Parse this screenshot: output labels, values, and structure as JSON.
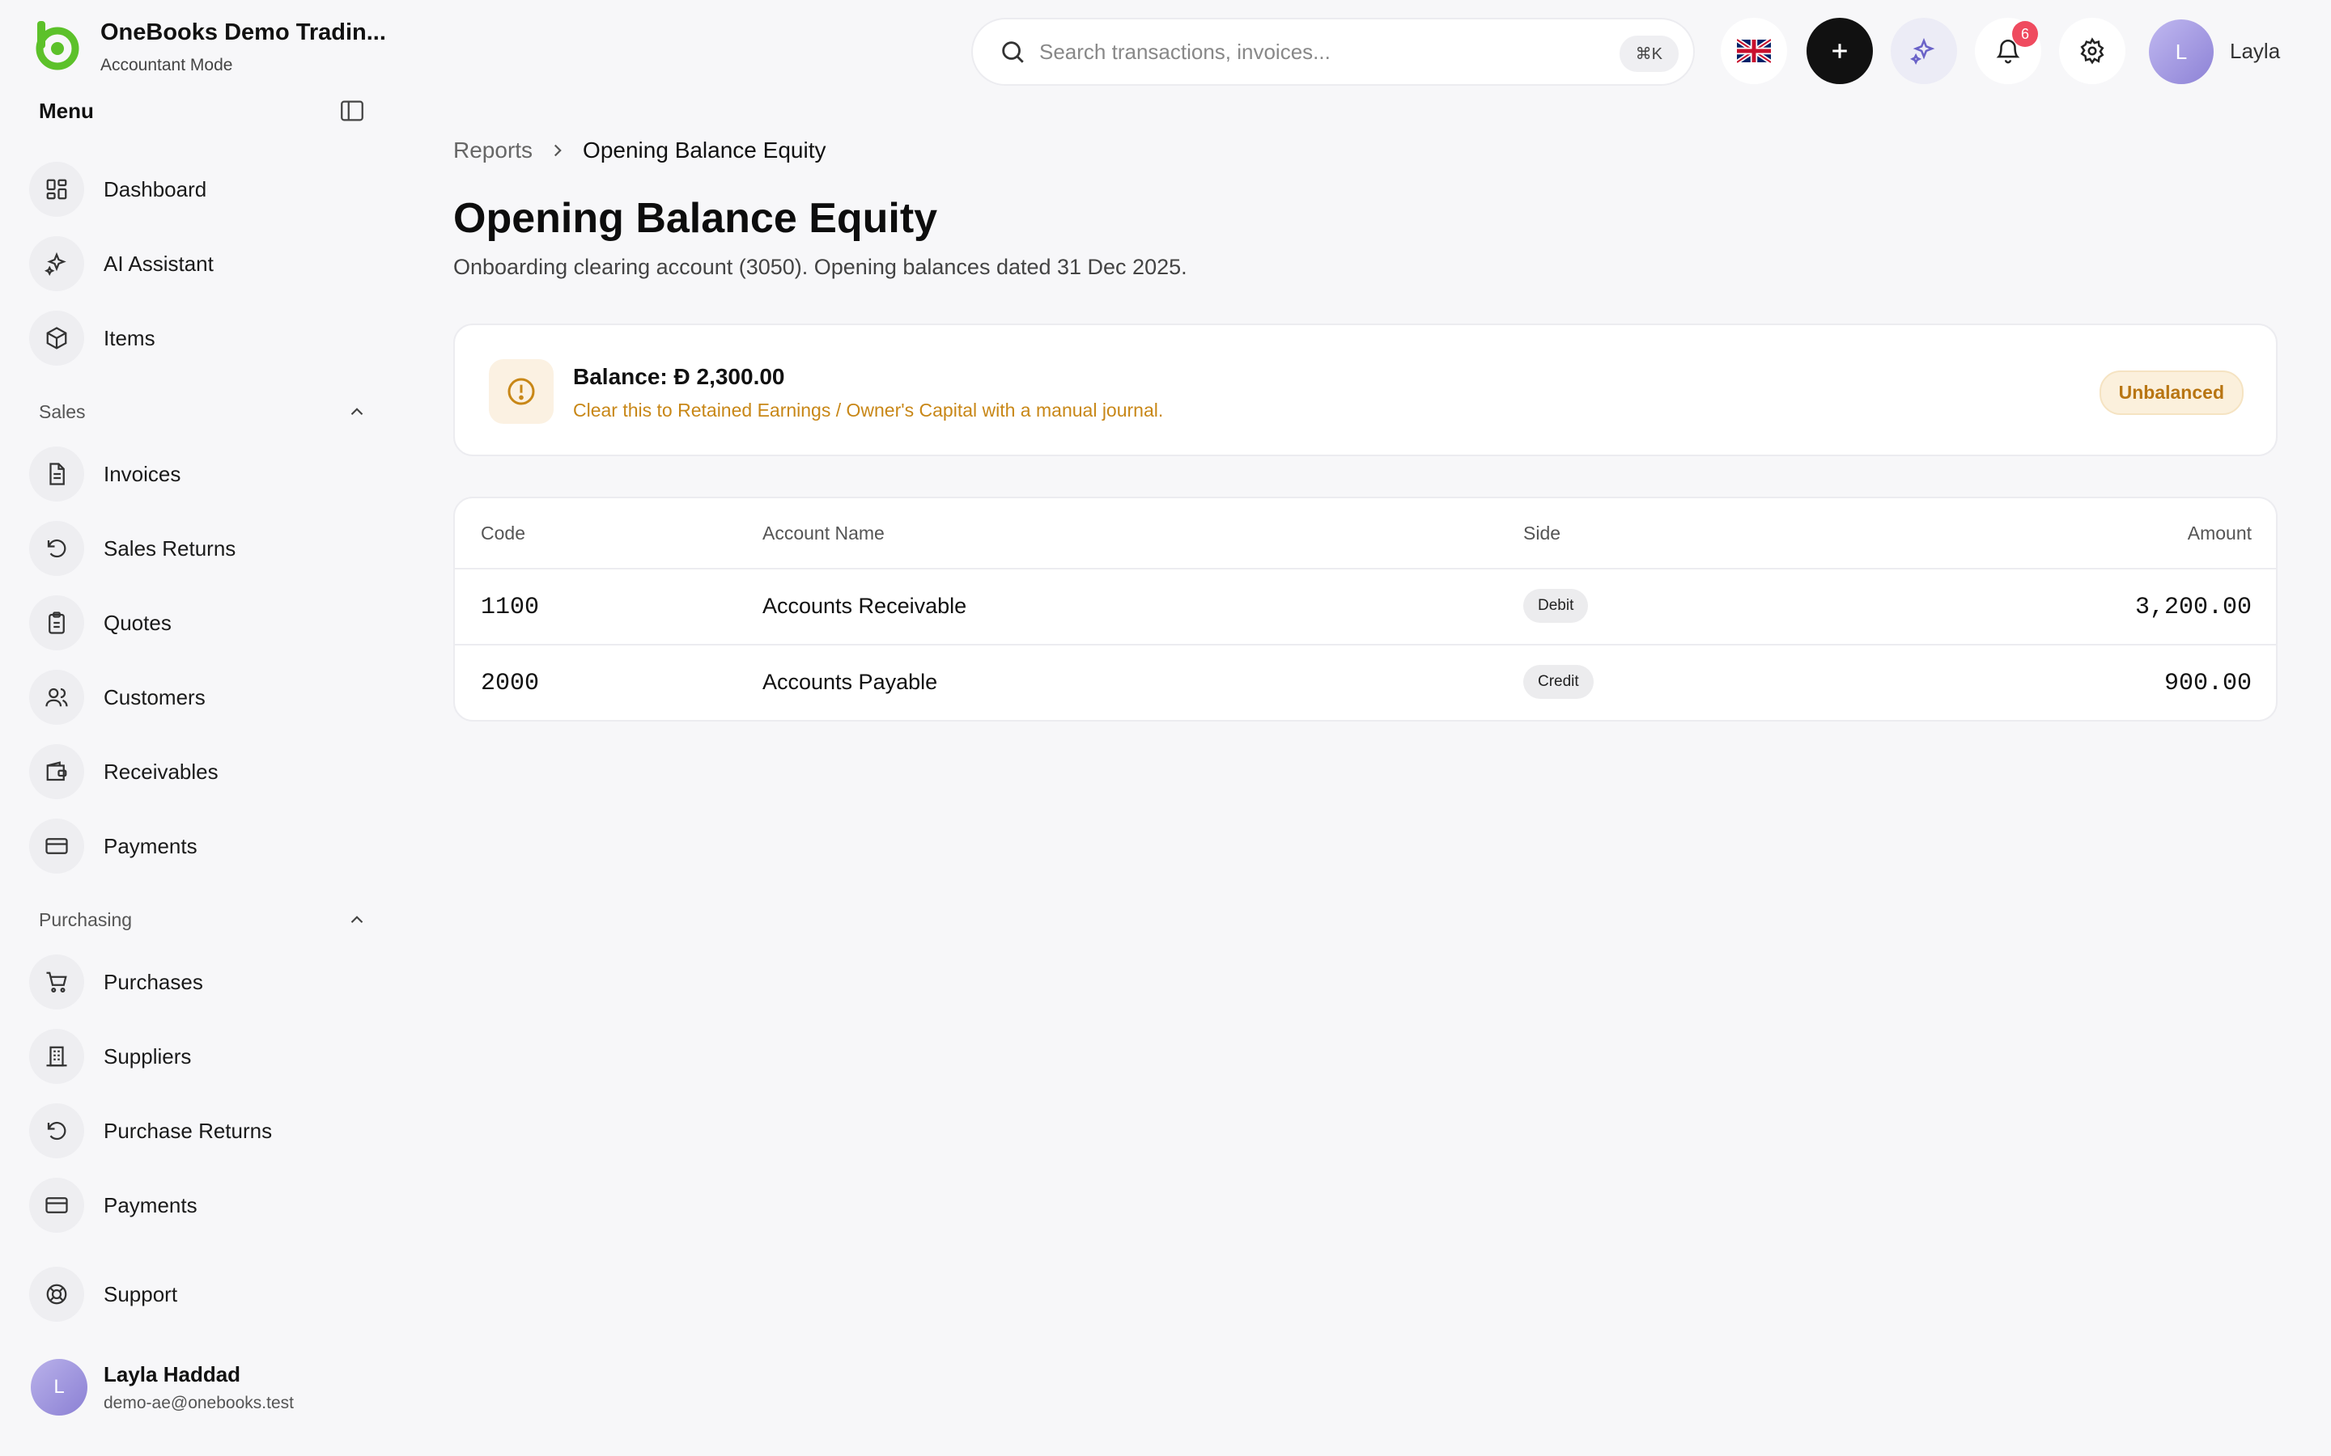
{
  "company": {
    "name": "OneBooks Demo Tradin...",
    "mode": "Accountant Mode"
  },
  "menu": {
    "title": "Menu"
  },
  "nav_top": [
    {
      "label": "Dashboard",
      "icon": "dashboard-icon"
    },
    {
      "label": "AI Assistant",
      "icon": "sparkles-icon"
    },
    {
      "label": "Items",
      "icon": "box-icon"
    }
  ],
  "sales": {
    "title": "Sales",
    "items": [
      {
        "label": "Invoices",
        "icon": "file-icon"
      },
      {
        "label": "Sales Returns",
        "icon": "undo-icon"
      },
      {
        "label": "Quotes",
        "icon": "clipboard-icon"
      },
      {
        "label": "Customers",
        "icon": "users-icon"
      },
      {
        "label": "Receivables",
        "icon": "wallet-icon"
      },
      {
        "label": "Payments",
        "icon": "card-icon"
      }
    ]
  },
  "purchasing": {
    "title": "Purchasing",
    "items": [
      {
        "label": "Purchases",
        "icon": "cart-icon"
      },
      {
        "label": "Suppliers",
        "icon": "building-icon"
      },
      {
        "label": "Purchase Returns",
        "icon": "undo-icon"
      },
      {
        "label": "Payments",
        "icon": "card-icon"
      }
    ]
  },
  "support": {
    "label": "Support"
  },
  "user": {
    "name": "Layla Haddad",
    "email": "demo-ae@onebooks.test",
    "initial": "L",
    "short_name": "Layla"
  },
  "search": {
    "placeholder": "Search transactions, invoices...",
    "shortcut": "⌘K"
  },
  "notifications": {
    "count": "6"
  },
  "breadcrumb": {
    "parent": "Reports",
    "current": "Opening Balance Equity"
  },
  "page": {
    "title": "Opening Balance Equity",
    "subtitle": "Onboarding clearing account (3050). Opening balances dated 31 Dec 2025."
  },
  "alert": {
    "title": "Balance: Ð 2,300.00",
    "description": "Clear this to Retained Earnings / Owner's Capital with a manual journal.",
    "status": "Unbalanced"
  },
  "table": {
    "headers": {
      "code": "Code",
      "name": "Account Name",
      "side": "Side",
      "amount": "Amount"
    },
    "rows": [
      {
        "code": "1100",
        "name": "Accounts Receivable",
        "side": "Debit",
        "amount": "3,200.00"
      },
      {
        "code": "2000",
        "name": "Accounts Payable",
        "side": "Credit",
        "amount": "900.00"
      }
    ]
  },
  "colors": {
    "brand": "#5cc12a",
    "warning": "#c88717",
    "badge": "#ef4b5f"
  }
}
